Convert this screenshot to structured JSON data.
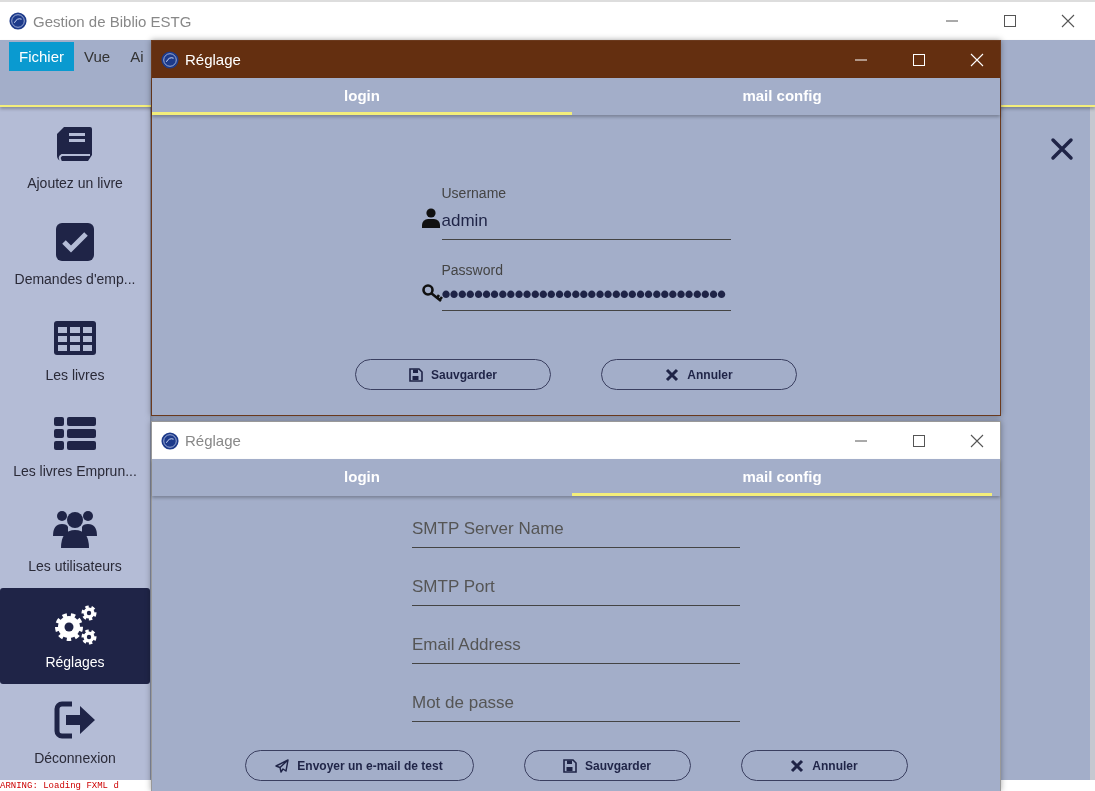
{
  "window": {
    "title": "Gestion de Biblio ESTG"
  },
  "menu": [
    {
      "label": "Fichier",
      "selected": true
    },
    {
      "label": "Vue",
      "selected": false
    },
    {
      "label": "Ai",
      "selected": false
    }
  ],
  "sidebar": {
    "items": [
      {
        "label": "Ajoutez un livre",
        "kind": "book",
        "selected": false
      },
      {
        "label": "Demandes d'emp...",
        "kind": "check",
        "selected": false
      },
      {
        "label": "Les livres",
        "kind": "table",
        "selected": false
      },
      {
        "label": "Les livres Emprun...",
        "kind": "list",
        "selected": false
      },
      {
        "label": "Les utilisateurs",
        "kind": "users",
        "selected": false
      },
      {
        "label": "Réglages",
        "kind": "gears",
        "selected": true
      },
      {
        "label": "Déconnexion",
        "kind": "signout",
        "selected": false
      }
    ]
  },
  "console": {
    "text": "ARNING: Loading FXML d"
  },
  "dialogs": [
    {
      "title": "Réglage",
      "active": true,
      "tabs": [
        {
          "label": "login",
          "selected": true
        },
        {
          "label": "mail config",
          "selected": false
        }
      ],
      "fields": [
        {
          "kind": "user",
          "label": "Username",
          "value": "admin"
        },
        {
          "kind": "password",
          "label": "Password",
          "value": "•••••••••••••••••••••••••••••••••••"
        }
      ],
      "buttons": [
        {
          "label": "Sauvgarder",
          "kind": "save"
        },
        {
          "label": "Annuler",
          "kind": "cancel"
        }
      ]
    },
    {
      "title": "Réglage",
      "active": false,
      "tabs": [
        {
          "label": "login",
          "selected": false
        },
        {
          "label": "mail config",
          "selected": true
        }
      ],
      "fields": [
        {
          "kind": "text",
          "placeholder": "SMTP Server Name"
        },
        {
          "kind": "text",
          "placeholder": "SMTP Port"
        },
        {
          "kind": "text",
          "placeholder": "Email Address"
        },
        {
          "kind": "text",
          "placeholder": "Mot de passe"
        }
      ],
      "buttons": [
        {
          "label": "Envoyer un e-mail de test",
          "kind": "send"
        },
        {
          "label": "Sauvgarder",
          "kind": "save"
        },
        {
          "label": "Annuler",
          "kind": "cancel"
        }
      ]
    }
  ]
}
